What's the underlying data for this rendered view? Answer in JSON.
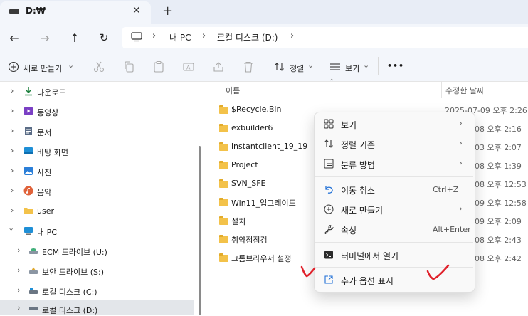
{
  "tab": {
    "title": "D:₩",
    "close": "✕",
    "new_tab": "+"
  },
  "nav": {
    "back": "←",
    "forward": "→",
    "up": "↑",
    "refresh": "↻",
    "breadcrumbs": [
      "내 PC",
      "로컬 디스크 (D:)"
    ],
    "sep": "›"
  },
  "toolbar": {
    "new_label": "새로 만들기",
    "sort_label": "정렬",
    "view_label": "보기",
    "more": "•••",
    "caret": "⌄"
  },
  "sidebar": {
    "items": [
      {
        "label": "다운로드",
        "icon": "download-icon"
      },
      {
        "label": "동영상",
        "icon": "video-icon"
      },
      {
        "label": "문서",
        "icon": "document-icon"
      },
      {
        "label": "바탕 화면",
        "icon": "desktop-icon"
      },
      {
        "label": "사진",
        "icon": "photo-icon"
      },
      {
        "label": "음악",
        "icon": "music-icon"
      },
      {
        "label": "user",
        "icon": "folder-icon"
      },
      {
        "label": "내 PC",
        "icon": "pc-icon"
      },
      {
        "label": "ECM 드라이브 (U:)",
        "icon": "drive-icon"
      },
      {
        "label": "보안 드라이브 (S:)",
        "icon": "drive-icon"
      },
      {
        "label": "로컬 디스크 (C:)",
        "icon": "drive-icon"
      },
      {
        "label": "로컬 디스크 (D:)",
        "icon": "drive-icon"
      }
    ]
  },
  "content": {
    "col_name": "이름",
    "col_date": "수정한 날짜",
    "files": [
      {
        "name": "$Recycle.Bin",
        "date": "2025-07-09 오후 2:26"
      },
      {
        "name": "exbuilder6",
        "date": "08 오후 2:16"
      },
      {
        "name": "instantclient_19_19",
        "date": "03 오후 2:07"
      },
      {
        "name": "Project",
        "date": "08 오후 1:39"
      },
      {
        "name": "SVN_SFE",
        "date": "08 오후 12:53"
      },
      {
        "name": "Win11_업그레이드",
        "date": "09 오후 12:58"
      },
      {
        "name": "설치",
        "date": "09 오후 2:09"
      },
      {
        "name": "취약점점검",
        "date": "08 오후 2:43"
      },
      {
        "name": "크롬브라우저 설정",
        "date": "08 오후 2:42"
      }
    ]
  },
  "menu": {
    "view": "보기",
    "sort_by": "정렬 기준",
    "group_by": "분류 방법",
    "undo_move": "이동 취소",
    "undo_shortcut": "Ctrl+Z",
    "new": "새로 만들기",
    "properties": "속성",
    "properties_shortcut": "Alt+Enter",
    "open_terminal": "터미널에서 열기",
    "more_options": "추가 옵션 표시",
    "arrow": "›"
  },
  "colors": {
    "accent": "#0067c0",
    "annotation": "#e0202a",
    "folder": "#f3c24a"
  }
}
